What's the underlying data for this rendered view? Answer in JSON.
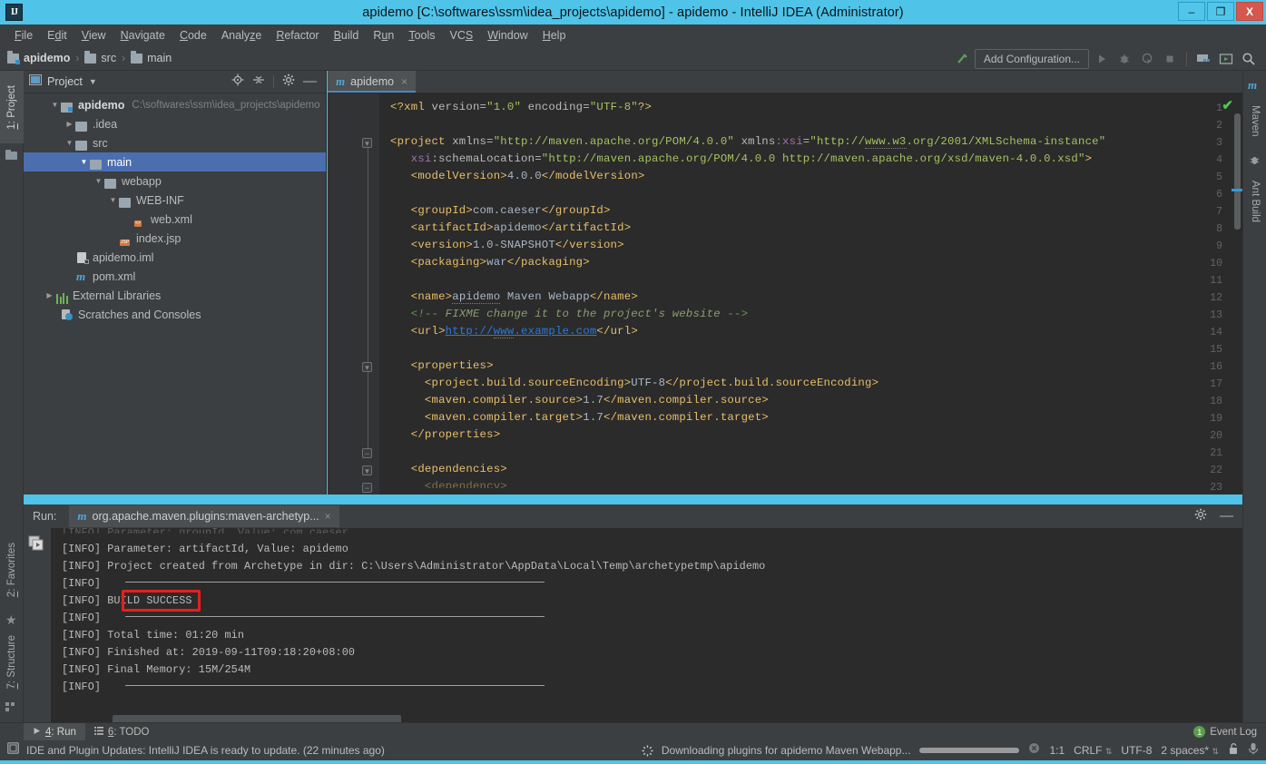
{
  "window": {
    "title": "apidemo [C:\\softwares\\ssm\\idea_projects\\apidemo] - apidemo - IntelliJ IDEA (Administrator)",
    "logo": "IJ",
    "minimize": "–",
    "maximize": "❐",
    "close": "X"
  },
  "menubar": {
    "items": [
      {
        "label": "File"
      },
      {
        "label": "Edit"
      },
      {
        "label": "View"
      },
      {
        "label": "Navigate"
      },
      {
        "label": "Code"
      },
      {
        "label": "Analyze"
      },
      {
        "label": "Refactor"
      },
      {
        "label": "Build"
      },
      {
        "label": "Run"
      },
      {
        "label": "Tools"
      },
      {
        "label": "VCS"
      },
      {
        "label": "Window"
      },
      {
        "label": "Help"
      }
    ]
  },
  "navbar": {
    "breadcrumbs": [
      {
        "label": "apidemo"
      },
      {
        "label": "src"
      },
      {
        "label": "main"
      }
    ],
    "separator": "›",
    "add_configuration": "Add Configuration..."
  },
  "left_strip": {
    "tabs": [
      {
        "label": "1: Project"
      },
      {
        "label": "2: Favorites"
      },
      {
        "label": "7: Structure"
      }
    ]
  },
  "right_strip": {
    "tabs": [
      {
        "label": "Maven"
      },
      {
        "label": "Ant Build"
      }
    ]
  },
  "project_panel": {
    "title": "Project",
    "caret": "▼",
    "tree": [
      {
        "indent": 0,
        "arrow": "▼",
        "icon": "project-folder-icon",
        "label": "apidemo",
        "bold": true,
        "path": "C:\\softwares\\ssm\\idea_projects\\apidemo",
        "selected": false
      },
      {
        "indent": 1,
        "arrow": "▶",
        "icon": "folder-icon",
        "label": ".idea",
        "bold": false,
        "path": "",
        "selected": false
      },
      {
        "indent": 1,
        "arrow": "▼",
        "icon": "folder-icon",
        "label": "src",
        "bold": false,
        "path": "",
        "selected": false
      },
      {
        "indent": 2,
        "arrow": "▼",
        "icon": "folder-icon",
        "label": "main",
        "bold": false,
        "path": "",
        "selected": true
      },
      {
        "indent": 3,
        "arrow": "▼",
        "icon": "folder-icon",
        "label": "webapp",
        "bold": false,
        "path": "",
        "selected": false
      },
      {
        "indent": 4,
        "arrow": "▼",
        "icon": "folder-icon",
        "label": "WEB-INF",
        "bold": false,
        "path": "",
        "selected": false
      },
      {
        "indent": 5,
        "arrow": "",
        "icon": "xml-file-icon",
        "label": "web.xml",
        "bold": false,
        "path": "",
        "selected": false
      },
      {
        "indent": 4,
        "arrow": "",
        "icon": "jsp-file-icon",
        "label": "index.jsp",
        "bold": false,
        "path": "",
        "selected": false
      },
      {
        "indent": 2,
        "arrow": "",
        "icon": "iml-file-icon",
        "label": "apidemo.iml",
        "bold": false,
        "path": "",
        "selected": false
      },
      {
        "indent": 2,
        "arrow": "",
        "icon": "maven-file-icon",
        "label": "pom.xml",
        "bold": false,
        "path": "",
        "selected": false
      },
      {
        "indent": 0,
        "arrow": "▶",
        "icon": "library-icon",
        "label": "External Libraries",
        "bold": false,
        "path": "",
        "selected": false
      },
      {
        "indent": 1,
        "arrow": "",
        "icon": "scratches-icon",
        "label": "Scratches and Consoles",
        "bold": false,
        "path": "",
        "selected": false
      }
    ]
  },
  "editor": {
    "tab": {
      "label": "apidemo",
      "icon": "maven-file-icon",
      "close": "×"
    },
    "line_count": 23,
    "code_lines": [
      {
        "n": 1,
        "fold": "",
        "html": "<span class=\"tag\">&lt;?xml </span><span class=\"attrn\">version=</span><span class=\"str\">\"1.0\"</span><span class=\"attrn\"> encoding=</span><span class=\"str\">\"UTF-8\"</span><span class=\"tag\">?&gt;</span>"
      },
      {
        "n": 2,
        "fold": "",
        "html": ""
      },
      {
        "n": 3,
        "fold": "open",
        "html": "<span class=\"tag\">&lt;project </span><span class=\"attrn\">xmlns=</span><span class=\"str\">\"http://maven.apache.org/POM/4.0.0\"</span><span class=\"attrn\"> xmlns</span><span class=\"nsattr\">:xsi</span><span class=\"attrn\">=</span><span class=\"str\">\"http://<span class=\"squig\">www.w3</span>.org/2001/XMLSchema-instance\"</span>"
      },
      {
        "n": 4,
        "fold": "",
        "html": "   <span class=\"nsattr\">xsi</span><span class=\"attrn\">:schemaLocation=</span><span class=\"str\">\"http://maven.apache.org/POM/4.0.0 http://maven.apache.org/xsd/maven-4.0.0.xsd\"</span><span class=\"tag\">&gt;</span>"
      },
      {
        "n": 5,
        "fold": "",
        "html": "   <span class=\"tag\">&lt;modelVersion&gt;</span><span class=\"txt\">4.0.0</span><span class=\"tag\">&lt;/modelVersion&gt;</span>"
      },
      {
        "n": 6,
        "fold": "",
        "html": ""
      },
      {
        "n": 7,
        "fold": "",
        "html": "   <span class=\"tag\">&lt;groupId&gt;</span><span class=\"txt\">com.caeser</span><span class=\"tag\">&lt;/groupId&gt;</span>"
      },
      {
        "n": 8,
        "fold": "",
        "html": "   <span class=\"tag\">&lt;artifactId&gt;</span><span class=\"txt\">apidemo</span><span class=\"tag\">&lt;/artifactId&gt;</span>"
      },
      {
        "n": 9,
        "fold": "",
        "html": "   <span class=\"tag\">&lt;version&gt;</span><span class=\"txt\">1.0-SNAPSHOT</span><span class=\"tag\">&lt;/version&gt;</span>"
      },
      {
        "n": 10,
        "fold": "",
        "html": "   <span class=\"tag\">&lt;packaging&gt;</span><span class=\"txt\">war</span><span class=\"tag\">&lt;/packaging&gt;</span>"
      },
      {
        "n": 11,
        "fold": "",
        "html": ""
      },
      {
        "n": 12,
        "fold": "",
        "html": "   <span class=\"tag\">&lt;name&gt;</span><span class=\"txt\"><span class=\"squig\">apidemo</span> Maven Webapp</span><span class=\"tag\">&lt;/name&gt;</span>"
      },
      {
        "n": 13,
        "fold": "",
        "html": "   <span class=\"cmt\">&lt;!-- </span><span class=\"cmtb\">FIXME change it to the project's website</span><span class=\"cmt\"> --&gt;</span>"
      },
      {
        "n": 14,
        "fold": "",
        "html": "   <span class=\"tag\">&lt;url&gt;</span><span class=\"link\">http://<span class=\"squig\">www</span>.example.com</span><span class=\"tag\">&lt;/url&gt;</span>"
      },
      {
        "n": 15,
        "fold": "",
        "html": ""
      },
      {
        "n": 16,
        "fold": "open",
        "html": "   <span class=\"tag\">&lt;properties&gt;</span>"
      },
      {
        "n": 17,
        "fold": "",
        "html": "     <span class=\"tag\">&lt;project.build.sourceEncoding&gt;</span><span class=\"txt\">UTF-8</span><span class=\"tag\">&lt;/project.build.sourceEncoding&gt;</span>"
      },
      {
        "n": 18,
        "fold": "",
        "html": "     <span class=\"tag\">&lt;maven.compiler.source&gt;</span><span class=\"txt\">1.7</span><span class=\"tag\">&lt;/maven.compiler.source&gt;</span>"
      },
      {
        "n": 19,
        "fold": "",
        "html": "     <span class=\"tag\">&lt;maven.compiler.target&gt;</span><span class=\"txt\">1.7</span><span class=\"tag\">&lt;/maven.compiler.target&gt;</span>"
      },
      {
        "n": 20,
        "fold": "close",
        "html": "   <span class=\"tag\">&lt;/properties&gt;</span>"
      },
      {
        "n": 21,
        "fold": "",
        "html": ""
      },
      {
        "n": 22,
        "fold": "open",
        "html": "   <span class=\"tag\">&lt;dependencies&gt;</span>"
      },
      {
        "n": 23,
        "fold": "open",
        "html": "     <span class=\"tag\">&lt;dependency&gt;</span>"
      }
    ],
    "inspection_status": "✔"
  },
  "run_panel": {
    "label": "Run:",
    "tab_title": "org.apache.maven.plugins:maven-archetyp...",
    "tab_close": "×",
    "console_lines": [
      {
        "prefix": "[INFO]",
        "text": " Parameter: groupId, Value: com.caeser",
        "clipped": true
      },
      {
        "prefix": "[INFO]",
        "text": " Parameter: artifactId, Value: apidemo"
      },
      {
        "prefix": "[INFO]",
        "text": " Project created from Archetype in dir: C:\\Users\\Administrator\\AppData\\Local\\Temp\\archetypetmp\\apidemo"
      },
      {
        "prefix": "[INFO]",
        "text": "",
        "rule": true
      },
      {
        "prefix": "[INFO]",
        "text": " BUILD SUCCESS",
        "highlight": true
      },
      {
        "prefix": "[INFO]",
        "text": "",
        "rule": true
      },
      {
        "prefix": "[INFO]",
        "text": " Total time: 01:20 min"
      },
      {
        "prefix": "[INFO]",
        "text": " Finished at: 2019-09-11T09:18:20+08:00"
      },
      {
        "prefix": "[INFO]",
        "text": " Final Memory: 15M/254M"
      },
      {
        "prefix": "[INFO]",
        "text": "",
        "rule": true
      }
    ]
  },
  "status_tabs": {
    "tabs": [
      {
        "label": "4: Run",
        "icon": "run-icon",
        "active": true
      },
      {
        "label": "6: TODO",
        "icon": "todo-icon",
        "active": false
      }
    ],
    "event_log": {
      "label": "Event Log",
      "count": "1"
    }
  },
  "statusbar": {
    "message": "IDE and Plugin Updates: IntelliJ IDEA is ready to update. (22 minutes ago)",
    "progress_text": "Downloading plugins for apidemo Maven Webapp...",
    "caret_position": "1:1",
    "line_separator": "CRLF",
    "encoding": "UTF-8",
    "indent": "2 spaces*",
    "lock_icon": "lock-icon",
    "inspector_icon": "inspector-icon"
  },
  "colors": {
    "title_bar": "#4fc3e8",
    "chrome": "#3c3f41",
    "editor_bg": "#2b2b2b",
    "selection": "#4b6eaf",
    "highlight_box": "#e81e1e",
    "accent_blue": "#4a88c7",
    "success_green": "#4ec94e"
  }
}
